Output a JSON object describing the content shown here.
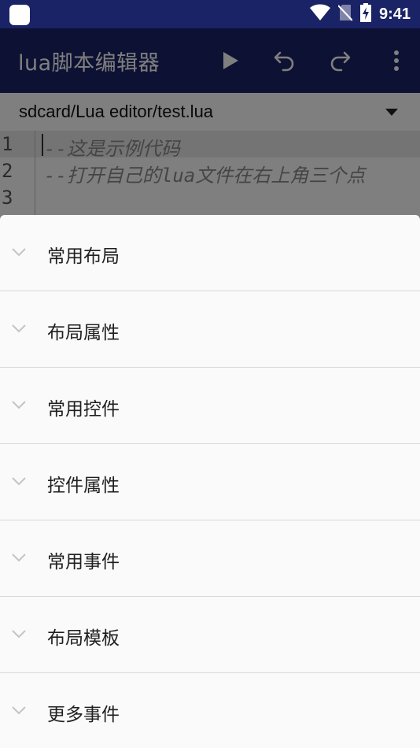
{
  "status_bar": {
    "time": "9:41",
    "icons": [
      "app-icon",
      "wifi-icon",
      "no-sim-icon",
      "battery-charging-icon"
    ]
  },
  "app_bar": {
    "title": "lua脚本编辑器",
    "actions": [
      "run-icon",
      "undo-icon",
      "redo-icon",
      "more-vert-icon"
    ],
    "color": "#1a2366"
  },
  "file_bar": {
    "path": "sdcard/Lua editor/test.lua"
  },
  "editor": {
    "lines": [
      {
        "num": "1",
        "text": "--这是示例代码"
      },
      {
        "num": "2",
        "text": "--打开自己的lua文件在右上角三个点"
      },
      {
        "num": "3",
        "text": ""
      }
    ]
  },
  "sheet": {
    "items": [
      {
        "label": "常用布局"
      },
      {
        "label": "布局属性"
      },
      {
        "label": "常用控件"
      },
      {
        "label": "控件属性"
      },
      {
        "label": "常用事件"
      },
      {
        "label": "布局模板"
      },
      {
        "label": "更多事件"
      }
    ]
  }
}
